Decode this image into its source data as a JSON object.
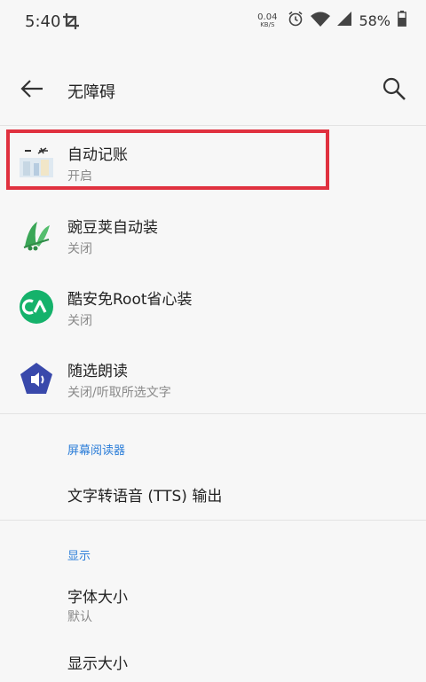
{
  "status_bar": {
    "time": "5:40",
    "net_speed_value": "0.04",
    "net_speed_unit": "KB/S",
    "battery": "58%"
  },
  "header": {
    "title": "无障碍"
  },
  "services": [
    {
      "title": "自动记账",
      "summary": "开启",
      "icon": "auto-bookkeeping-icon"
    },
    {
      "title": "豌豆荚自动装",
      "summary": "关闭",
      "icon": "wandoujia-icon"
    },
    {
      "title": "酷安免Root省心装",
      "summary": "关闭",
      "icon": "coolapk-icon"
    },
    {
      "title": "随选朗读",
      "summary": "关闭/听取所选文字",
      "icon": "select-to-speak-icon"
    }
  ],
  "screen_reader_section": {
    "header": "屏幕阅读器",
    "items": [
      {
        "title": "文字转语音 (TTS) 输出"
      }
    ]
  },
  "display_section": {
    "header": "显示",
    "items": [
      {
        "title": "字体大小",
        "summary": "默认"
      },
      {
        "title": "显示大小"
      }
    ]
  },
  "colors": {
    "accent": "#2b7dd8",
    "highlight": "#e0313f",
    "wandoujia_green": "#3aa657",
    "coolapk_green": "#15b26b",
    "select_to_speak_blue": "#3949ab"
  }
}
